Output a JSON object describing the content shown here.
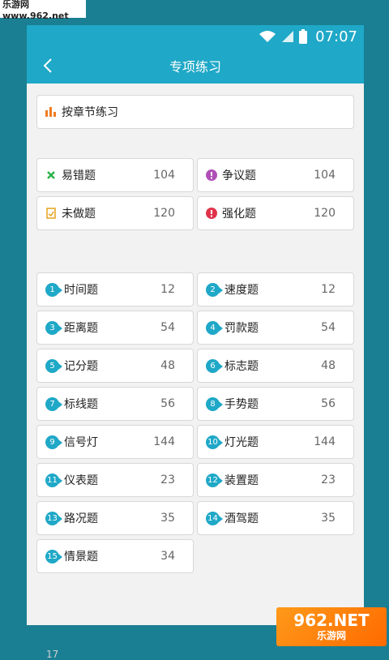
{
  "watermark_top": "乐游网 www.962.net",
  "status": {
    "time": "07:07"
  },
  "header": {
    "title": "专项练习"
  },
  "chapter_practice": {
    "label": "按章节练习"
  },
  "special": [
    {
      "label": "易错题",
      "count": "104",
      "icon": "cross-icon",
      "color": "#2db24a"
    },
    {
      "label": "争议题",
      "count": "104",
      "icon": "exclamation-icon",
      "color": "#b04fb7"
    },
    {
      "label": "未做题",
      "count": "120",
      "icon": "document-icon",
      "color": "#e6a21c"
    },
    {
      "label": "强化题",
      "count": "120",
      "icon": "exclamation-icon",
      "color": "#e0334b"
    }
  ],
  "topics": [
    {
      "num": "1",
      "label": "时间题",
      "count": "12"
    },
    {
      "num": "2",
      "label": "速度题",
      "count": "12"
    },
    {
      "num": "3",
      "label": "距离题",
      "count": "54"
    },
    {
      "num": "4",
      "label": "罚款题",
      "count": "54"
    },
    {
      "num": "5",
      "label": "记分题",
      "count": "48"
    },
    {
      "num": "6",
      "label": "标志题",
      "count": "48"
    },
    {
      "num": "7",
      "label": "标线题",
      "count": "56"
    },
    {
      "num": "8",
      "label": "手势题",
      "count": "56"
    },
    {
      "num": "9",
      "label": "信号灯",
      "count": "144"
    },
    {
      "num": "10",
      "label": "灯光题",
      "count": "144"
    },
    {
      "num": "11",
      "label": "仪表题",
      "count": "23"
    },
    {
      "num": "12",
      "label": "装置题",
      "count": "23"
    },
    {
      "num": "13",
      "label": "路况题",
      "count": "35"
    },
    {
      "num": "14",
      "label": "酒驾题",
      "count": "35"
    },
    {
      "num": "15",
      "label": "情景题",
      "count": "34"
    }
  ],
  "footer_number": "17",
  "watermark_br": {
    "big": "962.NET",
    "small": "乐游网"
  },
  "colors": {
    "primary": "#1fa8c7",
    "background": "#f2f2f2"
  }
}
